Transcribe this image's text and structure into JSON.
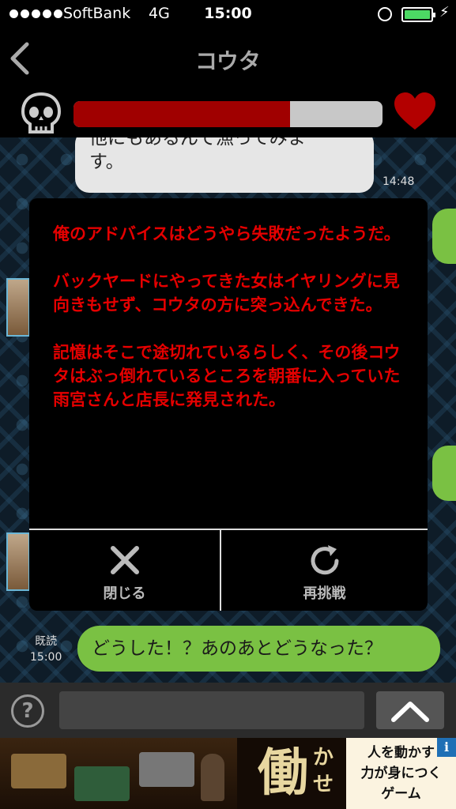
{
  "status_bar": {
    "carrier": "SoftBank",
    "network": "4G",
    "time": "15:00",
    "battery_level": 1.0
  },
  "nav": {
    "back_icon": "chevron-left-icon",
    "title": "コウタ"
  },
  "gauge": {
    "left_icon": "skull-icon",
    "right_icon": "heart-icon",
    "level": 0.7,
    "fill_color": "#a00000"
  },
  "chat": {
    "incoming": {
      "text": "他にもあるんで漁ってみます。",
      "line1": "他にもあるんで漁ってみま",
      "line2": "す。",
      "time": "14:48"
    },
    "outgoing": {
      "read_label": "既読",
      "time": "15:00",
      "text": "どうした！？あのあとどうなった？"
    }
  },
  "modal": {
    "paragraphs": [
      "俺のアドバイスはどうやら失敗だったようだ。",
      "バックヤードにやってきた女はイヤリングに見向きもせず、コウタの方に突っ込んできた。",
      "記憶はそこで途切れているらしく、その後コウタはぶっ倒れているところを朝番に入っていた雨宮さんと店長に発見された。"
    ],
    "close_label": "閉じる",
    "retry_label": "再挑戦",
    "text_color": "#e50000"
  },
  "input_bar": {
    "help_label": "?",
    "send_icon": "chevron-up-icon"
  },
  "ad": {
    "headline_char": "働",
    "headline_rest": "かせ",
    "copy": [
      "人を動かす",
      "力が身につく",
      "ゲーム"
    ],
    "info_label": "i"
  }
}
